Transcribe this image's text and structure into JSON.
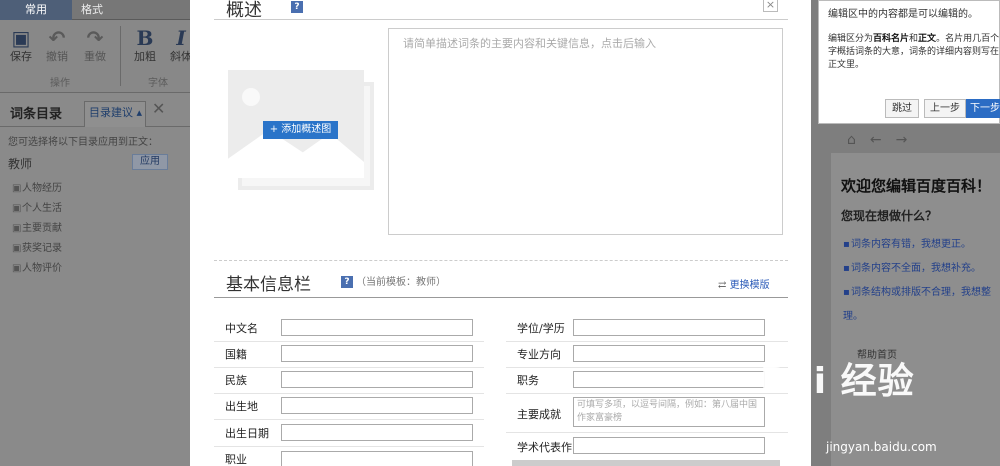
{
  "toolbar": {
    "tabs": [
      "常用",
      "格式"
    ],
    "buttons": [
      {
        "icon": "save-icon",
        "label": "保存"
      },
      {
        "icon": "undo-icon",
        "label": "撤销"
      },
      {
        "icon": "redo-icon",
        "label": "重做"
      },
      {
        "icon": "bold-icon",
        "label": "加粗"
      },
      {
        "icon": "italic-icon",
        "label": "斜体"
      }
    ],
    "groups": [
      "操作",
      "字体"
    ]
  },
  "catalog_panel": {
    "title": "词条目录",
    "tab": "目录建议",
    "hint": "您可选择将以下目录应用到正文：",
    "category": "教师",
    "apply_button": "应用",
    "items": [
      "人物经历",
      "个人生活",
      "主要贡献",
      "获奖记录",
      "人物评价"
    ]
  },
  "modal": {
    "summary_title": "概述",
    "help_glyph": "?",
    "close_glyph": "×",
    "add_image_button": "+ 添加概述图",
    "summary_placeholder": "请简单描述词条的主要内容和关键信息，点击后输入",
    "infobox_title": "基本信息栏",
    "infobox_template": "（当前模板：教师）",
    "change_template": "更换模版",
    "fields_left": [
      "中文名",
      "国籍",
      "民族",
      "出生地",
      "出生日期",
      "职业"
    ],
    "fields_right": [
      "学位/学历",
      "专业方向",
      "职务",
      "主要成就",
      "学术代表作"
    ],
    "achievement_placeholder": "可填写多项，以逗号间隔，例如：第八届中国作家富豪榜"
  },
  "guide_popup": {
    "title": "编辑区中的内容都是可以编辑的。",
    "body_prefix": "编辑区分为",
    "body_b1": "百科名片",
    "body_and": "和",
    "body_b2": "正文",
    "body_rest": "。名片用几百个字概括词条的大意，词条的详细内容则写在正文里。",
    "skip_button": "跳过",
    "prev_button": "上一步",
    "next_button": "下一步"
  },
  "welcome_panel": {
    "title": "欢迎您编辑百度百科！",
    "question": "您现在想做什么？",
    "options": [
      "词条内容有错，我想更正。",
      "词条内容不全面，我想补充。",
      "词条结构或排版不合理，我想整理。"
    ],
    "help_link": "帮助首页"
  },
  "watermark": {
    "brand": "Bai 经验",
    "url": "jingyan.baidu.com"
  }
}
